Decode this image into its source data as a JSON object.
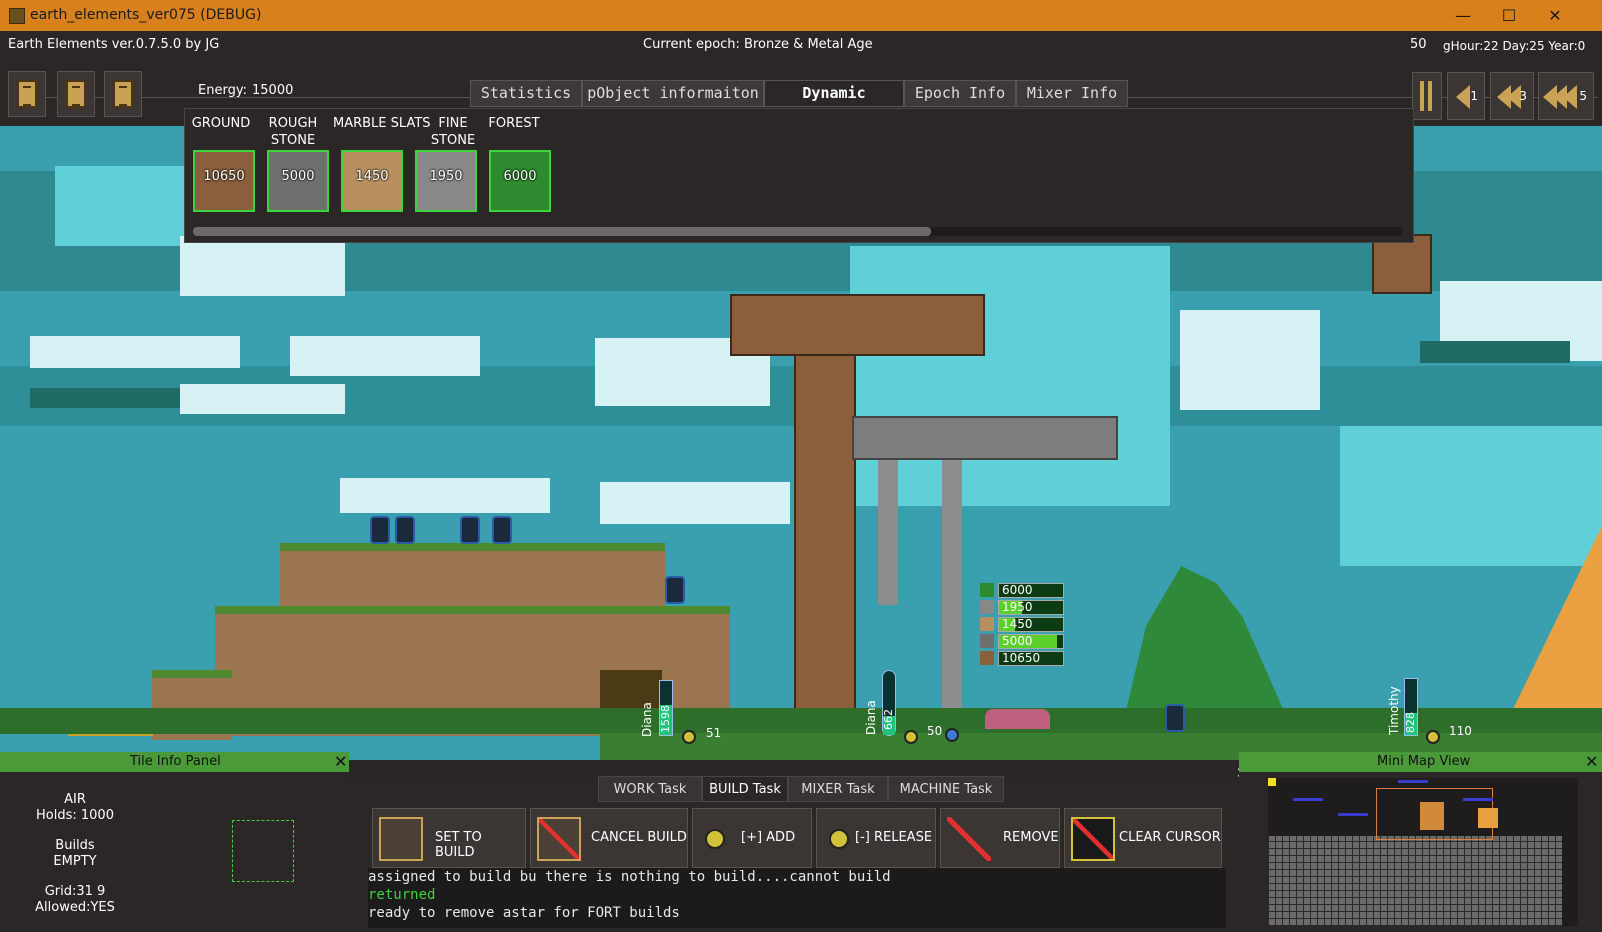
{
  "window": {
    "title": "earth_elements_ver075 (DEBUG)",
    "minimize": "—",
    "maximize": "☐",
    "close": "✕"
  },
  "header": {
    "app_label": "Earth Elements ver.0.7.5.0 by JG",
    "epoch": "Current epoch: Bronze & Metal Age",
    "speed_value": "50",
    "clock": "gHour:22 Day:25 Year:0",
    "energy_label": "Energy:",
    "energy_value": "15000",
    "nav_buttons": [
      {
        "label": "1"
      },
      {
        "label": "3"
      },
      {
        "label": "5"
      }
    ]
  },
  "tabs": [
    {
      "label": "Statistics",
      "active": false
    },
    {
      "label": "pObject informaiton",
      "active": false
    },
    {
      "label": "Dynamic Resources",
      "active": true
    },
    {
      "label": "Epoch Info",
      "active": false
    },
    {
      "label": "Mixer Info",
      "active": false
    }
  ],
  "resources": [
    {
      "label": "GROUND",
      "value": "10650",
      "color": "#8b5e3c"
    },
    {
      "label": "ROUGH\nSTONE",
      "value": "5000",
      "color": "#6f6f6f"
    },
    {
      "label": "MARBLE SLATS",
      "value": "1450",
      "color": "#b89060"
    },
    {
      "label": "FINE\nSTONE",
      "value": "1950",
      "color": "#888888"
    },
    {
      "label": "FOREST",
      "value": "6000",
      "color": "#2e8a2e"
    }
  ],
  "stack_bars": [
    {
      "value": "6000",
      "fill": 0.0,
      "color": "#2e8a2e"
    },
    {
      "value": "1950",
      "fill": 0.35,
      "color": "#5ccf2a"
    },
    {
      "value": "1450",
      "fill": 0.25,
      "color": "#5ccf2a"
    },
    {
      "value": "5000",
      "fill": 0.9,
      "color": "#5ccf2a"
    },
    {
      "value": "10650",
      "fill": 0.0,
      "color": "#2e8a2e"
    }
  ],
  "workers": [
    {
      "name": "Diana",
      "energy": "1598",
      "count": "51"
    },
    {
      "name": "Diana",
      "energy": "662",
      "count": "50"
    },
    {
      "name": "Timothy",
      "energy": "828",
      "count": "110"
    }
  ],
  "tile_info": {
    "title": "Tile Info Panel",
    "close": "✕",
    "type": "AIR",
    "holds": "Holds: 1000",
    "builds_label": "Builds",
    "builds_value": "EMPTY",
    "grid": "Grid:31 9",
    "allowed": "Allowed:YES"
  },
  "task_tabs": [
    {
      "label": "WORK Task",
      "active": false
    },
    {
      "label": "BUILD Task",
      "active": true
    },
    {
      "label": "MIXER Task",
      "active": false
    },
    {
      "label": "MACHINE Task",
      "active": false
    }
  ],
  "task_close": "✕",
  "actions": [
    {
      "label": "SET TO BUILD",
      "icon": "build-frame-icon"
    },
    {
      "label": "CANCEL BUILD",
      "icon": "cancel-build-icon"
    },
    {
      "label": "[+] ADD",
      "icon": "worker-add-icon"
    },
    {
      "label": "[-] RELEASE",
      "icon": "worker-release-icon"
    },
    {
      "label": "REMOVE",
      "icon": "remove-icon"
    },
    {
      "label": "CLEAR CURSOR",
      "icon": "clear-cursor-icon"
    }
  ],
  "log": [
    {
      "text": "assigned to build bu there is nothing to build....cannot build",
      "color": "#e8e8e8"
    },
    {
      "text": "returned",
      "color": "#3bd43b"
    },
    {
      "text": "ready to  remove astar for FORT builds",
      "color": "#e8e8e8"
    }
  ],
  "minimap": {
    "title": "Mini Map View",
    "close": "✕"
  }
}
